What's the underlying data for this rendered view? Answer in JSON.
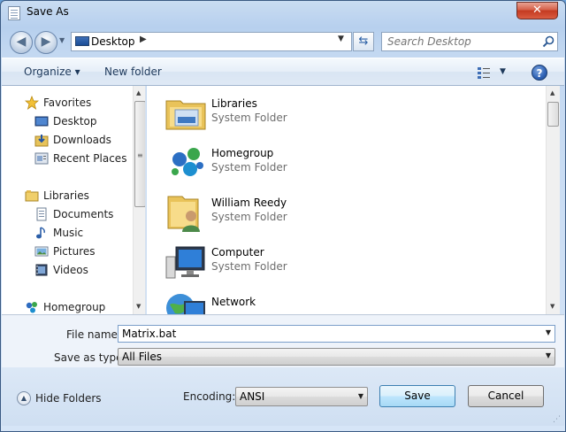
{
  "window": {
    "title": "Save As",
    "close_glyph": "✕"
  },
  "navigation": {
    "back_glyph": "◀",
    "forward_glyph": "▶",
    "address": {
      "location": "Desktop",
      "separator": "▶",
      "dropdown": "▼"
    },
    "refresh_glyph": "⇆",
    "search": {
      "placeholder": "Search Desktop"
    }
  },
  "toolbar": {
    "organize_label": "Organize ▾",
    "new_folder_label": "New folder",
    "view_dropdown": "▼",
    "help_glyph": "?"
  },
  "sidebar": {
    "items": [
      {
        "label": "Favorites",
        "icon": "star-icon"
      },
      {
        "label": "Desktop",
        "icon": "desktop-icon"
      },
      {
        "label": "Downloads",
        "icon": "downloads-icon"
      },
      {
        "label": "Recent Places",
        "icon": "recent-places-icon"
      },
      {
        "label": "Libraries",
        "icon": "libraries-icon"
      },
      {
        "label": "Documents",
        "icon": "documents-icon"
      },
      {
        "label": "Music",
        "icon": "music-icon"
      },
      {
        "label": "Pictures",
        "icon": "pictures-icon"
      },
      {
        "label": "Videos",
        "icon": "videos-icon"
      },
      {
        "label": "Homegroup",
        "icon": "homegroup-icon"
      }
    ]
  },
  "content": {
    "items": [
      {
        "name": "Libraries",
        "type": "System Folder",
        "icon": "libraries-folder-icon"
      },
      {
        "name": "Homegroup",
        "type": "System Folder",
        "icon": "homegroup-icon"
      },
      {
        "name": "William Reedy",
        "type": "System Folder",
        "icon": "user-folder-icon"
      },
      {
        "name": "Computer",
        "type": "System Folder",
        "icon": "computer-icon"
      },
      {
        "name": "Network",
        "type": "",
        "icon": "network-icon"
      }
    ]
  },
  "form": {
    "file_name_label": "File name:",
    "file_name_value": "Matrix.bat",
    "save_type_label": "Save as type:",
    "save_type_value": "All Files",
    "encoding_label": "Encoding:",
    "encoding_value": "ANSI"
  },
  "footer": {
    "hide_folders_label": "Hide Folders",
    "save_label": "Save",
    "cancel_label": "Cancel"
  }
}
